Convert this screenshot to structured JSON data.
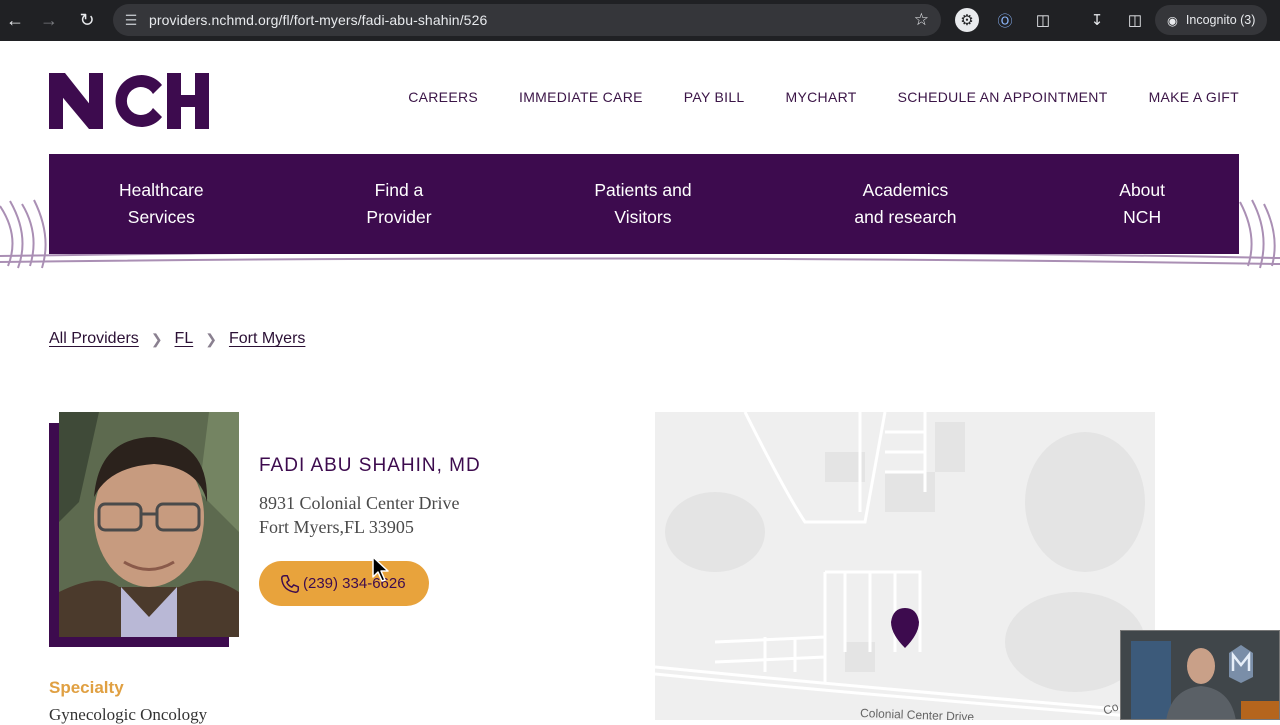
{
  "browser": {
    "url": "providers.nchmd.org/fl/fort-myers/fadi-abu-shahin/526",
    "profile_label": "Incognito (3)"
  },
  "site": {
    "logo_text": "NCH",
    "topnav": [
      "CAREERS",
      "IMMEDIATE CARE",
      "PAY BILL",
      "MYCHART",
      "SCHEDULE AN APPOINTMENT",
      "MAKE A GIFT"
    ],
    "mainnav": [
      "Healthcare\nServices",
      "Find a\nProvider",
      "Patients and\nVisitors",
      "Academics\nand research",
      "About\nNCH"
    ],
    "brand_color": "#3d0b4e",
    "accent_color": "#e8a33c"
  },
  "breadcrumb": [
    "All Providers",
    "FL",
    "Fort Myers"
  ],
  "provider": {
    "name": "FADI ABU SHAHIN, MD",
    "address_line1": "8931 Colonial Center Drive",
    "address_line2": "Fort Myers,FL 33905",
    "phone": "(239) 334-6626",
    "specialty_label": "Specialty",
    "specialty": "Gynecologic Oncology"
  },
  "map": {
    "street_label": "Colonial Center Drive",
    "street_label_2": "Co",
    "marker_icon": "map-pin-icon"
  }
}
